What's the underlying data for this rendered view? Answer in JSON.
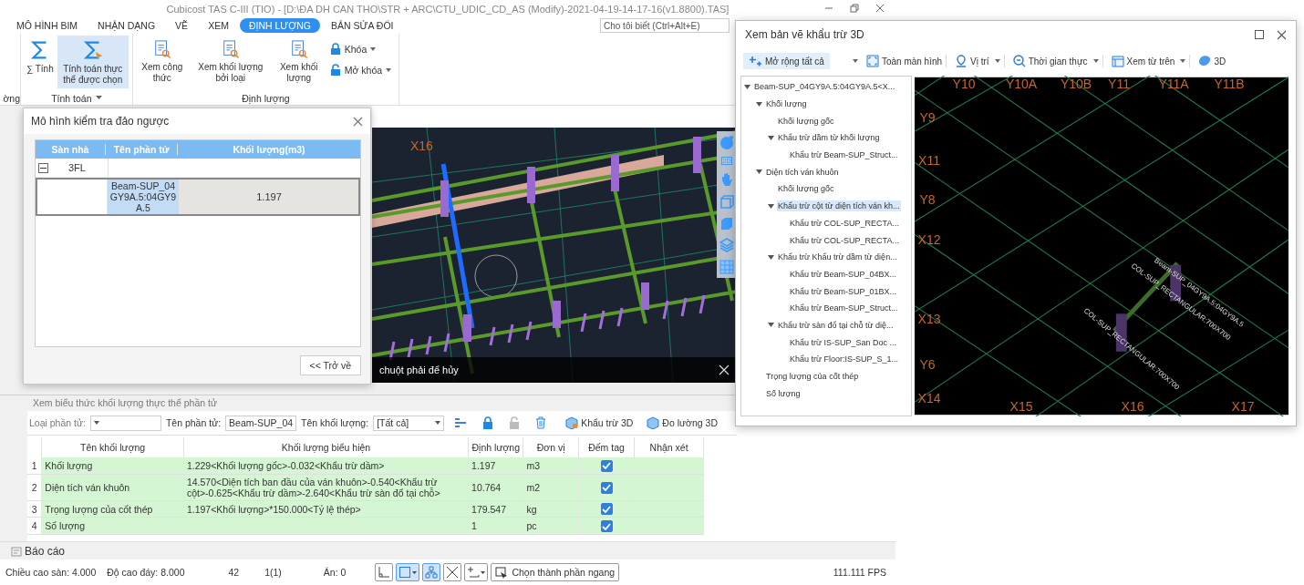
{
  "window": {
    "title": "Cubicost TAS C-III (TIO) - [D:\\ĐA DH CAN THO\\STR + ARC\\CTU_UDIC_CD_AS (Modify)-2021-04-19-14-17-16(v1.8800).TAS]"
  },
  "tabs": [
    {
      "label": "MÔ HÌNH BIM",
      "selected": false
    },
    {
      "label": "NHẬN DẠNG",
      "selected": false
    },
    {
      "label": "VẼ",
      "selected": false
    },
    {
      "label": "XEM",
      "selected": false
    },
    {
      "label": "ĐỊNH LƯỢNG",
      "selected": true
    },
    {
      "label": "BẢN SỬA ĐỔI",
      "selected": false
    }
  ],
  "search": {
    "placeholder": "Cho tôi biết (Ctrl+Alt+E)"
  },
  "ribbon": {
    "cut_group_label": "ờng",
    "calc_group": {
      "label": "Tính toán",
      "buttons": [
        {
          "label": "∑ Tính",
          "selected": false
        },
        {
          "label": "Tính toán thực thể được chọn",
          "selected": true
        }
      ]
    },
    "quantity_group": {
      "label": "Định lượng",
      "buttons": [
        {
          "label": "Xem công thức"
        },
        {
          "label": "Xem khối lượng bởi loại"
        },
        {
          "label": "Xem khối lượng"
        }
      ],
      "menu_buttons": [
        {
          "label": "Khóa"
        },
        {
          "label": "Mở khóa"
        }
      ]
    }
  },
  "dialog": {
    "title": "Mô hình kiểm tra đảo ngược",
    "columns": [
      "Sàn nhà",
      "Tên phần tử",
      "Khối lượng(m3)"
    ],
    "groups": [
      {
        "floor": "3FL",
        "expanded": true,
        "rows": [
          {
            "element": "Beam-SUP_04GY9A.5:04GY9A.5",
            "quantity": "1.197",
            "selected": true
          }
        ]
      }
    ],
    "back_button": "<< Trở về"
  },
  "viewport": {
    "grid_label": "X16",
    "hint": "chuột phải để hủy",
    "toolbar_label": "2D"
  },
  "expression_panel": {
    "title": "Xem biểu thức khối lượng thực thể phần tử",
    "filters": [
      {
        "label": "Loại phần tử:"
      },
      {
        "label": "Tên phần tử:",
        "value": "Beam-SUP_04"
      },
      {
        "label": "Tên khối lượng:",
        "value": "[Tất cả]"
      }
    ],
    "actions": [
      "Khẩu trừ 3D",
      "Đo lường 3D"
    ],
    "columns": [
      "Tên khối lượng",
      "Khối lượng biểu hiện",
      "Định lượng",
      "Đơn vị",
      "Đếm tag",
      "Nhận xét"
    ],
    "rows": [
      {
        "index": "1",
        "name": "Khối lượng",
        "expression": "1.229<Khối lượng gốc>-0.032<Khẩu trừ dầm>",
        "amount": "1.197",
        "unit": "m3",
        "tag_counted": true
      },
      {
        "index": "2",
        "name": "Diện tích ván khuôn",
        "expression": "14.570<Diện tích ban đầu của ván khuôn>-0.540<Khẩu trừ cột>-0.625<Khẩu trừ dầm>-2.640<Khẩu trừ sàn đổ tại chỗ>",
        "amount": "10.764",
        "unit": "m2",
        "tag_counted": true
      },
      {
        "index": "3",
        "name": "Trọng lượng của cốt thép",
        "expression": "1.197<Khối lượng>*150.000<Tỷ lệ thép>",
        "amount": "179.547",
        "unit": "kg",
        "tag_counted": true
      },
      {
        "index": "4",
        "name": "Số lượng",
        "amount": "1",
        "unit": "pc",
        "tag_counted": true
      }
    ]
  },
  "report_tab": "Báo cáo",
  "status_bar": {
    "items": [
      "Chiều cao sàn: 4.000",
      "Độ cao đáy: 8.000",
      "42",
      "1(1)",
      "Ẩn: 0"
    ],
    "tools": [
      {
        "selected": false,
        "dropdown": false
      },
      {
        "selected": true,
        "dropdown": true
      },
      {
        "selected": true,
        "dropdown": false
      },
      {
        "selected": false,
        "dropdown": false
      },
      {
        "selected": false,
        "dropdown": true
      }
    ],
    "select_button": "Chọn thành phần ngang",
    "fps": "111.111 FPS"
  },
  "viewer": {
    "title": "Xem bản vẽ khẩu trừ 3D",
    "expand_all": "Mở rộng tất cả",
    "buttons": [
      {
        "label": "Toàn màn hình",
        "dropdown": false
      },
      {
        "label": "Vị trí",
        "dropdown": true
      },
      {
        "label": "Thời gian thực",
        "dropdown": true
      },
      {
        "label": "Xem từ trên",
        "dropdown": true
      },
      {
        "label": "3D",
        "dropdown": false
      }
    ],
    "tree": [
      {
        "label": "Beam-SUP_04GY9A.5:04GY9A.5<X...",
        "selected": false,
        "expanded": true,
        "children": [
          {
            "label": "Khối lượng",
            "selected": false,
            "expanded": true,
            "children": [
              {
                "label": "Khối lượng gốc",
                "selected": false
              },
              {
                "label": "Khẩu trừ dầm từ khối lượng",
                "selected": false,
                "expanded": true,
                "children": [
                  {
                    "label": "Khẩu trừ Beam-SUP_Struct...",
                    "selected": false
                  }
                ]
              }
            ]
          },
          {
            "label": "Diện tích ván khuôn",
            "selected": false,
            "expanded": true,
            "children": [
              {
                "label": "Khối lượng gốc",
                "selected": false
              },
              {
                "label": "Khẩu trừ cột từ diện tích ván kh...",
                "selected": true,
                "expanded": true,
                "children": [
                  {
                    "label": "Khẩu trừ COL-SUP_RECTA...",
                    "selected": false
                  },
                  {
                    "label": "Khẩu trừ COL-SUP_RECTA...",
                    "selected": false
                  }
                ]
              },
              {
                "label": "Khẩu trừ Khẩu trừ dầm từ diện...",
                "selected": false,
                "expanded": true,
                "children": [
                  {
                    "label": "Khẩu trừ Beam-SUP_04BX...",
                    "selected": false
                  },
                  {
                    "label": "Khẩu trừ Beam-SUP_01BX...",
                    "selected": false
                  },
                  {
                    "label": "Khẩu trừ Beam-SUP_Struct...",
                    "selected": false
                  }
                ]
              },
              {
                "label": "Khẩu trừ sàn đổ tại chỗ từ diệ...",
                "selected": false,
                "expanded": true,
                "children": [
                  {
                    "label": "Khẩu trừ IS-SUP_San Doc ...",
                    "selected": false
                  },
                  {
                    "label": "Khẩu trừ Floor:IS-SUP_S_1...",
                    "selected": false
                  }
                ]
              }
            ]
          },
          {
            "label": "Trọng lượng của cốt thép",
            "selected": false
          },
          {
            "label": "Số lượng",
            "selected": false
          }
        ]
      }
    ],
    "grid_labels": [
      "Y10",
      "Y10A",
      "Y10B",
      "Y11",
      "Y11A",
      "Y11B",
      "Y9",
      "X11",
      "Y8",
      "X12",
      "X13",
      "Y6",
      "X14",
      "X15",
      "X16",
      "X17"
    ],
    "element_labels": [
      "Beam-SUP_04GY9A.5:04GY9A.5",
      "COL-SUP_RECTANGULAR:700X700",
      "COL-SUP_RECTANGULAR:700X700"
    ]
  }
}
